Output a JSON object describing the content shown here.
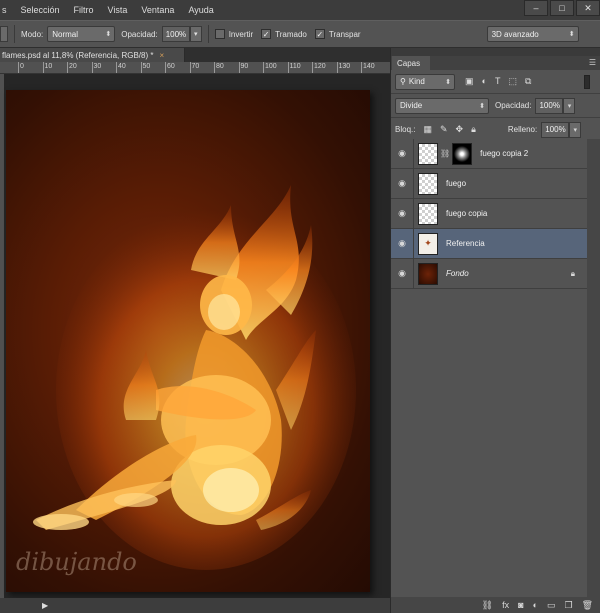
{
  "menu": [
    "s",
    "Selección",
    "Filtro",
    "Vista",
    "Ventana",
    "Ayuda"
  ],
  "window_buttons": [
    "–",
    "□",
    "✕"
  ],
  "options": {
    "mode_label": "Modo:",
    "mode_value": "Normal",
    "opacity_label": "Opacidad:",
    "opacity_value": "100%",
    "invert_label": "Invertir",
    "dither_label": "Tramado",
    "transparency_label": "Transpar",
    "workspace": "3D avanzado"
  },
  "document": {
    "tab_title": "flames.psd al 11,8% (Referencia, RGB/8) *",
    "ruler_ticks": [
      "0",
      "10",
      "20",
      "30",
      "40",
      "50",
      "60",
      "70",
      "80",
      "90",
      "100",
      "110",
      "120",
      "130",
      "140"
    ],
    "signature": "dibujando"
  },
  "layers_panel": {
    "tab": "Capas",
    "filter_kind": "Kind",
    "blend_mode": "Divide",
    "opacity_label": "Opacidad:",
    "opacity_value": "100%",
    "lock_label": "Bloq.:",
    "fill_label": "Relleno:",
    "fill_value": "100%",
    "layers": [
      {
        "name": "fuego copia 2",
        "has_mask": true,
        "selected": false
      },
      {
        "name": "fuego",
        "has_mask": false,
        "selected": false
      },
      {
        "name": "fuego copia",
        "has_mask": false,
        "selected": false
      },
      {
        "name": "Referencia",
        "has_mask": false,
        "selected": true
      },
      {
        "name": "Fondo",
        "has_mask": false,
        "selected": false,
        "locked": true
      }
    ]
  },
  "colors": {
    "selected_layer": "#57657a",
    "canvas_bg": "#5b1d05"
  }
}
